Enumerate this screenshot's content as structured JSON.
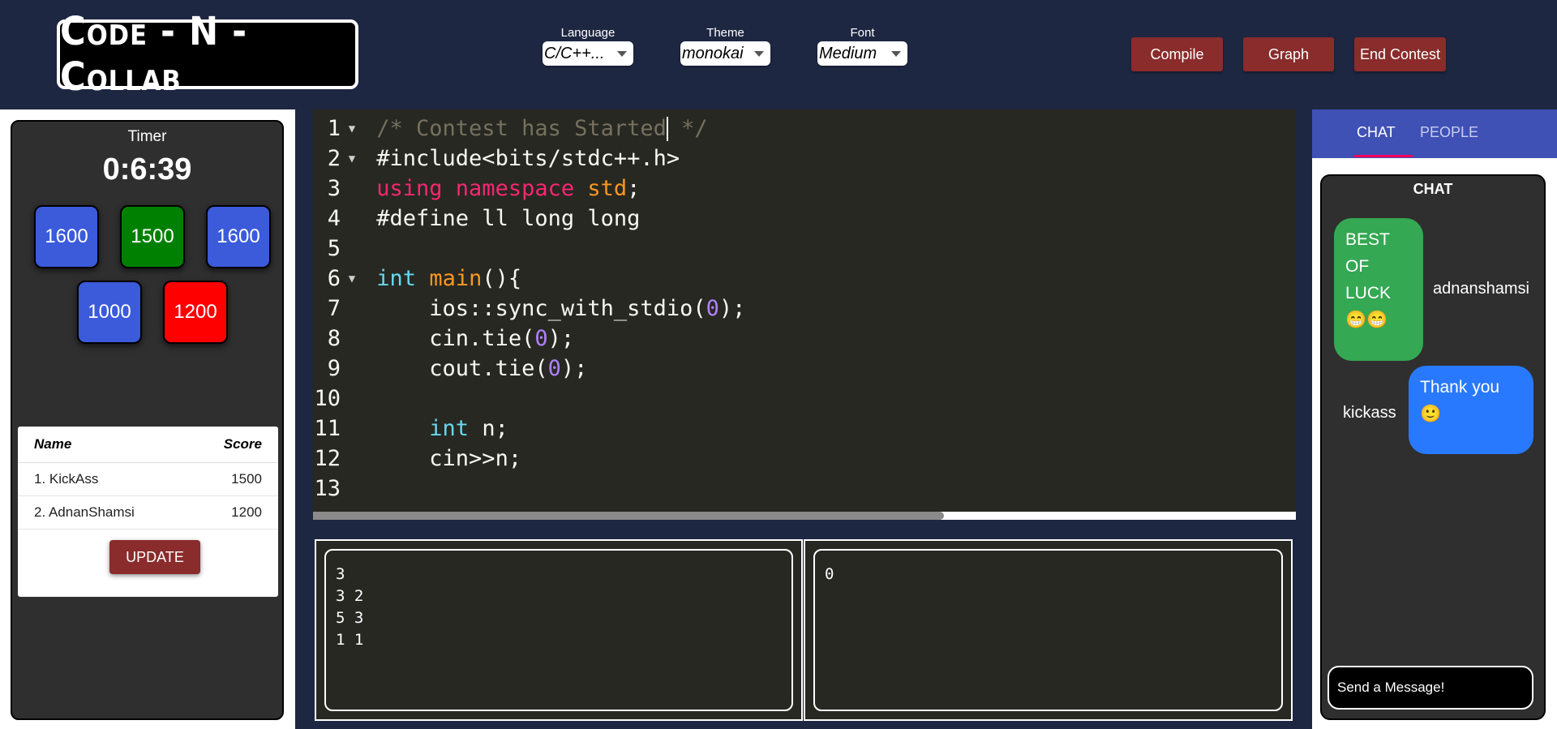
{
  "header": {
    "logo": "Code - N - Collab",
    "language": {
      "label": "Language",
      "value": "C/C++..."
    },
    "theme": {
      "label": "Theme",
      "value": "monokai"
    },
    "font": {
      "label": "Font",
      "value": "Medium"
    },
    "buttons": {
      "compile": "Compile",
      "graph": "Graph",
      "end": "End Contest"
    }
  },
  "timer": {
    "label": "Timer",
    "value": "0:6:39"
  },
  "problems": [
    {
      "rating": "1600",
      "color": "#3b5bdb"
    },
    {
      "rating": "1500",
      "color": "#008000"
    },
    {
      "rating": "1600",
      "color": "#3b5bdb"
    },
    {
      "rating": "1000",
      "color": "#3b5bdb"
    },
    {
      "rating": "1200",
      "color": "#ff0000"
    }
  ],
  "leaderboard": {
    "col_name": "Name",
    "col_score": "Score",
    "rows": [
      {
        "name": "1. KickAss",
        "score": "1500"
      },
      {
        "name": "2. AdnanShamsi",
        "score": "1200"
      }
    ],
    "update_label": "UPDATE"
  },
  "editor": {
    "line_numbers": [
      "1",
      "2",
      "3",
      "4",
      "5",
      "6",
      "7",
      "8",
      "9",
      "10",
      "11",
      "12",
      "13"
    ],
    "line1": {
      "a": "/* Contest has Started",
      "b": " */"
    },
    "line2": "#include<bits/stdc++.h>",
    "line3": {
      "kw": "using namespace",
      "ns": "std",
      "end": ";"
    },
    "line4": "#define ll long long",
    "line6": {
      "type": "int",
      "fn": "main",
      "end": "(){"
    },
    "line7": {
      "a": "    ios::sync_with_stdio(",
      "num": "0",
      "b": ");"
    },
    "line8": {
      "a": "    cin.tie(",
      "num": "0",
      "b": ");"
    },
    "line9": {
      "a": "    cout.tie(",
      "num": "0",
      "b": ");"
    },
    "line11": {
      "type": "int",
      "rest": " n;"
    },
    "line12": "    cin>>n;"
  },
  "io": {
    "input": "3\n3 2\n5 3\n1 1",
    "output": "0"
  },
  "chat": {
    "tabs": {
      "chat": "CHAT",
      "people": "PEOPLE"
    },
    "title": "CHAT",
    "messages": [
      {
        "user": "adnanshamsi",
        "text": "BEST\nOF\nLUCK\n😁😁",
        "color": "#34a853"
      },
      {
        "user": "kickass",
        "text": "Thank you\n🙂",
        "color": "#2979ff"
      }
    ],
    "input_placeholder": "Send a Message!"
  }
}
